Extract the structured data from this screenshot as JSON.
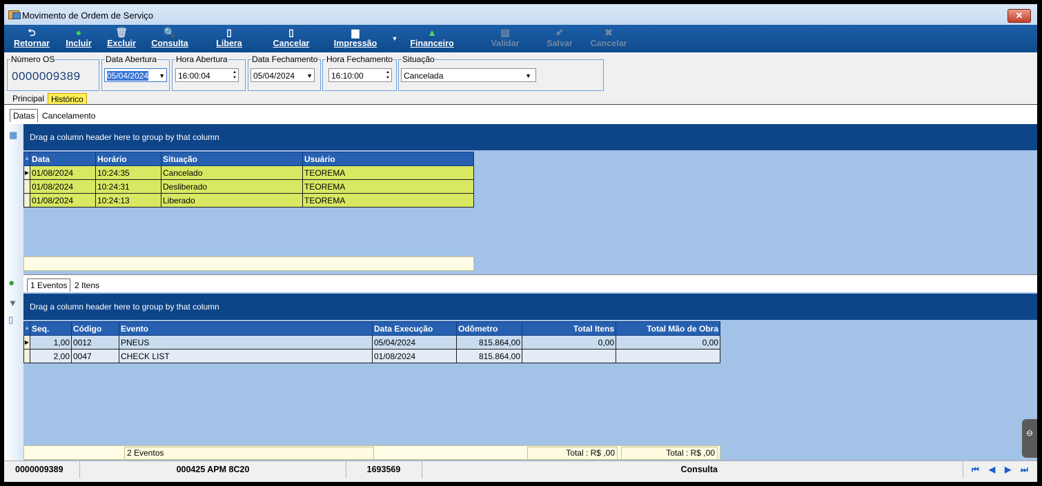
{
  "window": {
    "title": "Movimento de Ordem de Serviço",
    "close": "✕"
  },
  "toolbar": {
    "retornar": "Retornar",
    "incluir": "Incluir",
    "excluir": "Excluir",
    "consulta": "Consulta",
    "libera": "Libera",
    "cancelar": "Cancelar",
    "impressao": "Impressão",
    "financeiro": "Financeiro",
    "validar": "Validar",
    "salvar": "Salvar",
    "cancelar2": "Cancelar"
  },
  "header": {
    "numero_os_label": "Número OS",
    "numero_os": "0000009389",
    "data_abertura_label": "Data Abertura",
    "data_abertura": "05/04/2024",
    "hora_abertura_label": "Hora Abertura",
    "hora_abertura": "16:00:04",
    "data_fechamento_label": "Data Fechamento",
    "data_fechamento": "05/04/2024",
    "hora_fechamento_label": "Hora Fechamento",
    "hora_fechamento": "16:10:00",
    "situacao_label": "Situação",
    "situacao": "Cancelada"
  },
  "tabs_main": [
    "Principal",
    "Histórico"
  ],
  "tabs_hist": [
    "Datas",
    "Cancelamento"
  ],
  "group_hint": "Drag a column header here to group by that column",
  "datas_grid": {
    "columns": [
      "Data",
      "Horário",
      "Situação",
      "Usuário"
    ],
    "rows": [
      [
        "01/08/2024",
        "10:24:35",
        "Cancelado",
        "TEOREMA"
      ],
      [
        "01/08/2024",
        "10:24:31",
        "Desliberado",
        "TEOREMA"
      ],
      [
        "01/08/2024",
        "10:24:13",
        "Liberado",
        "TEOREMA"
      ]
    ]
  },
  "tabs_bottom": [
    "1 Eventos",
    "2 Itens"
  ],
  "eventos_grid": {
    "columns": [
      "Seq.",
      "Código",
      "Evento",
      "Data Execução",
      "Odômetro",
      "Total Itens",
      "Total Mão de Obra"
    ],
    "rows": [
      [
        "1,00",
        "0012",
        "PNEUS",
        "05/04/2024",
        "815.864,00",
        "0,00",
        "0,00"
      ],
      [
        "2,00",
        "0047",
        "CHECK LIST",
        "01/08/2024",
        "815.864,00",
        "",
        ""
      ]
    ],
    "footer_count": "2 Eventos",
    "footer_total_itens": "Total : R$ ,00",
    "footer_total_mao": "Total : R$ ,00"
  },
  "statusbar": {
    "os": "0000009389",
    "veiculo": "000425 APM 8C20",
    "codigo": "1693569",
    "modo": "Consulta"
  }
}
